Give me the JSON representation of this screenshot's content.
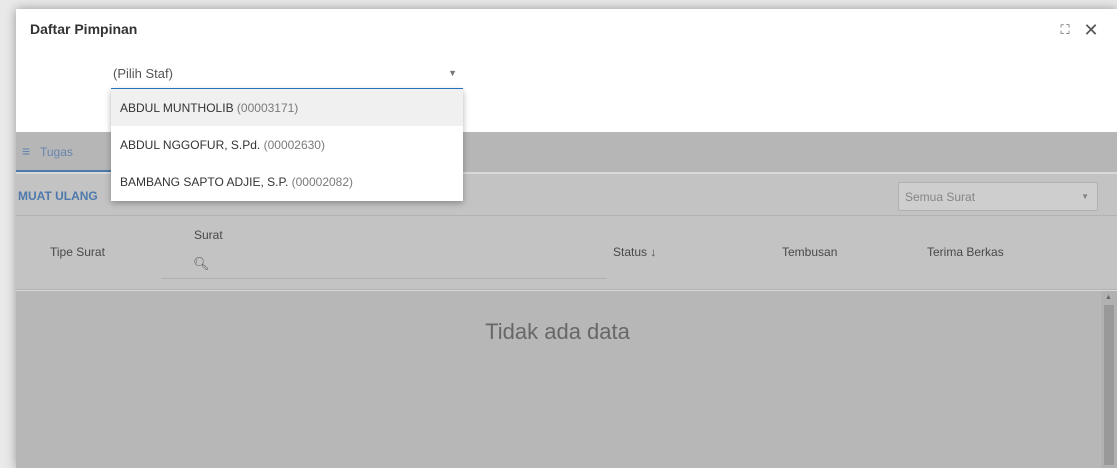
{
  "dialog": {
    "title": "Daftar Pimpinan",
    "maximize_icon": "maximize-icon",
    "close_icon": "close-icon"
  },
  "staff_select": {
    "value": "(Pilih Staf)",
    "options": [
      {
        "name": "ABDUL MUNTHOLIB",
        "code": "(00003171)"
      },
      {
        "name": "ABDUL NGGOFUR, S.Pd.",
        "code": "(00002630)"
      },
      {
        "name": "BAMBANG SAPTO ADJIE, S.P.",
        "code": "(00002082)"
      }
    ]
  },
  "tabs": [
    {
      "label": "Tugas",
      "icon": "list-icon"
    }
  ],
  "toolbar": {
    "reload_label": "MUAT ULANG",
    "filter_value": "Semua Surat"
  },
  "table": {
    "columns": [
      "Tipe Surat",
      "Surat",
      "Status",
      "Tembusan",
      "Terima Berkas"
    ],
    "status_sort": "↓",
    "empty_text": "Tidak ada data"
  },
  "colors": {
    "accent": "#5b8fca"
  }
}
